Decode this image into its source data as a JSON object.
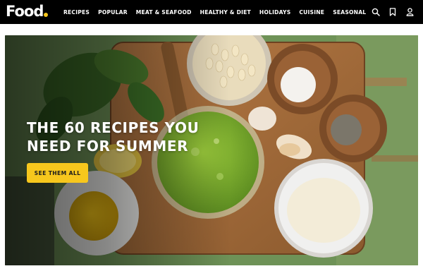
{
  "brand": {
    "name": "Food",
    "accent": "#f7c71d"
  },
  "nav": {
    "items": [
      "RECIPES",
      "POPULAR",
      "MEAT & SEAFOOD",
      "HEALTHY & DIET",
      "HOLIDAYS",
      "CUISINE",
      "SEASONAL"
    ],
    "icons": [
      "search-icon",
      "bookmark-icon",
      "user-icon"
    ]
  },
  "hero": {
    "headline_line1": "THE 60 RECIPES YOU",
    "headline_line2": "NEED FOR SUMMER",
    "cta_label": "SEE THEM ALL"
  },
  "colors": {
    "nav_background": "#000000",
    "button": "#f7c71d",
    "pesto": "#7fb030"
  }
}
